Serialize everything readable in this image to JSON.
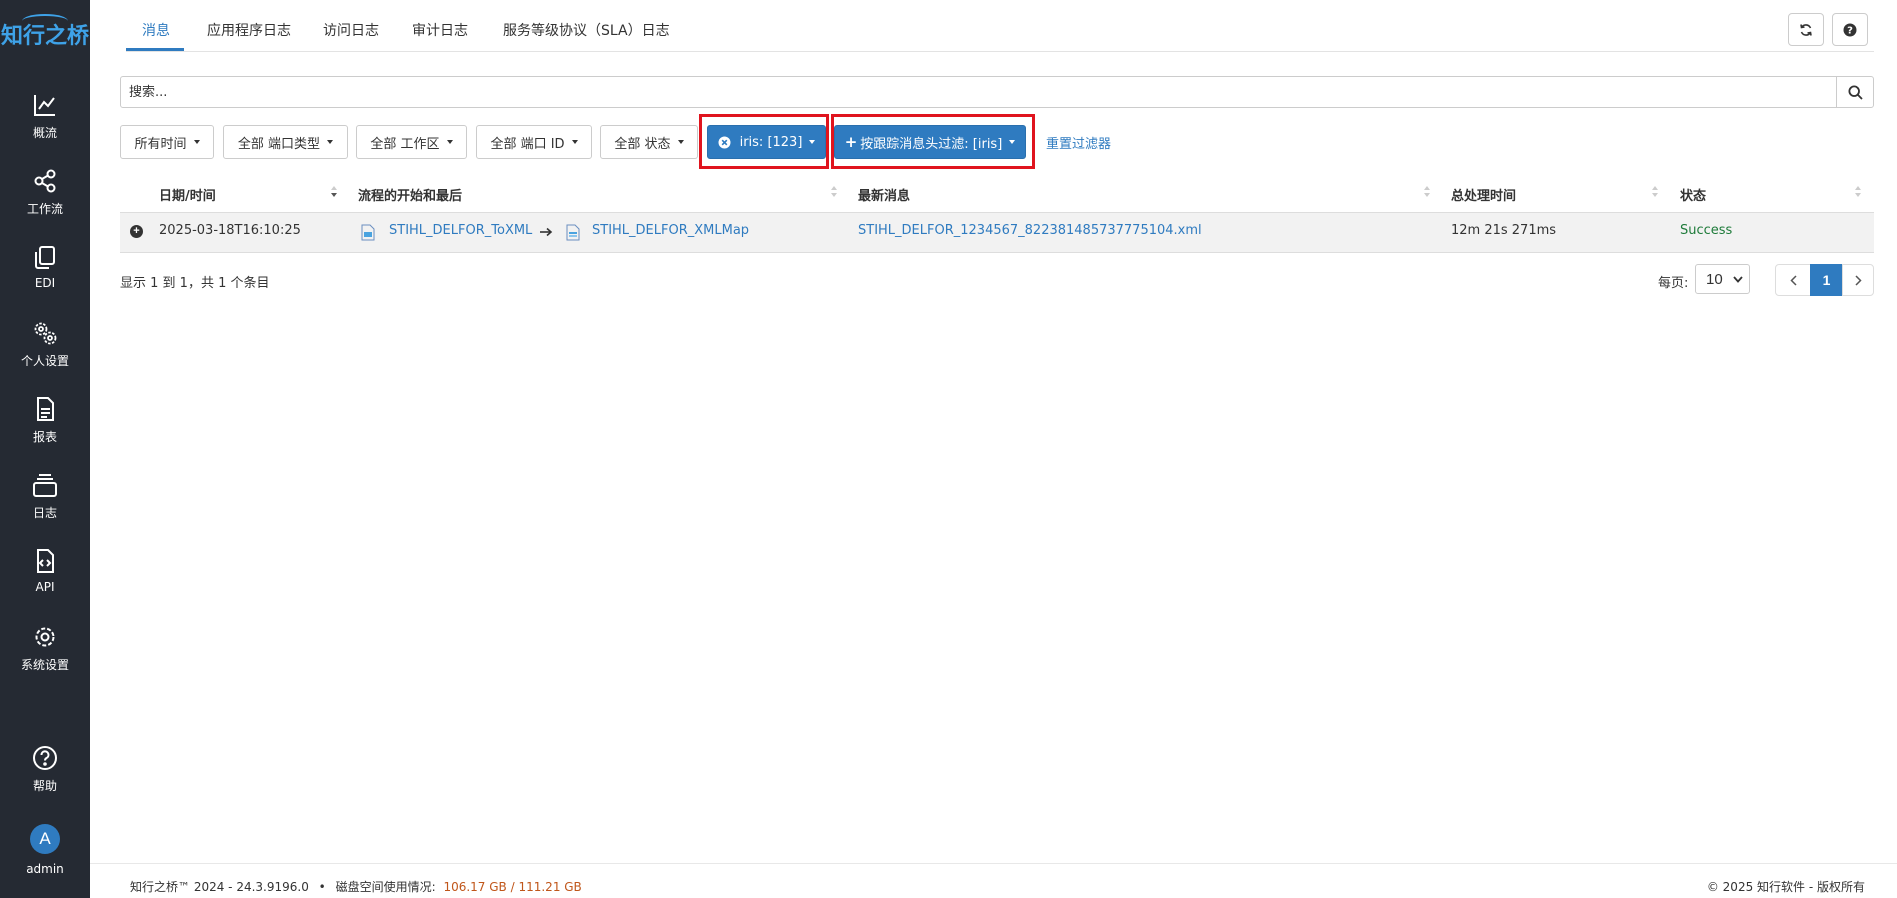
{
  "sidebar": {
    "logo": "知行之桥",
    "items": [
      {
        "label": "概流",
        "icon": "chart-line-icon"
      },
      {
        "label": "工作流",
        "icon": "share-nodes-icon"
      },
      {
        "label": "EDI",
        "icon": "copy-icon"
      },
      {
        "label": "个人设置",
        "icon": "gears-icon"
      },
      {
        "label": "报表",
        "icon": "file-lines-icon"
      },
      {
        "label": "日志",
        "icon": "layers-icon"
      },
      {
        "label": "API",
        "icon": "file-code-icon"
      },
      {
        "label": "系统设置",
        "icon": "gear-icon"
      },
      {
        "label": "帮助",
        "icon": "question-circle-icon"
      }
    ],
    "user": {
      "initial": "A",
      "name": "admin"
    }
  },
  "tabs": [
    {
      "label": "消息",
      "active": true
    },
    {
      "label": "应用程序日志"
    },
    {
      "label": "访问日志"
    },
    {
      "label": "审计日志"
    },
    {
      "label": "服务等级协议（SLA）日志"
    }
  ],
  "search": {
    "placeholder": "搜索..."
  },
  "filters": {
    "time": "所有时间",
    "port_type": "全部 端口类型",
    "workspace": "全部 工作区",
    "port_id": "全部 端口 ID",
    "status": "全部 状态",
    "iris": "iris: [123]",
    "header_filter": "按跟踪消息头过滤: [iris]",
    "reset": "重置过滤器"
  },
  "table": {
    "columns": [
      "日期/时间",
      "流程的开始和最后",
      "最新消息",
      "总处理时间",
      "状态"
    ],
    "rows": [
      {
        "datetime": "2025-03-18T16:10:25",
        "flow_start": "STIHL_DELFOR_ToXML",
        "flow_end": "STIHL_DELFOR_XMLMap",
        "latest_message": "STIHL_DELFOR_1234567_822381485737775104.xml",
        "total_time": "12m 21s 271ms",
        "status": "Success"
      }
    ]
  },
  "pagination": {
    "summary": "显示 1 到 1，共 1 个条目",
    "per_page_label": "每页:",
    "per_page_value": "10",
    "current_page": "1"
  },
  "footer": {
    "version": "知行之桥™ 2024 - 24.3.9196.0",
    "separator": "•",
    "disk_label": "磁盘空间使用情况:",
    "disk_value": "106.17 GB / 111.21 GB",
    "copyright": "© 2025 知行软件 - 版权所有"
  },
  "colors": {
    "sidebar_bg": "#252a33",
    "accent": "#2f7bc0",
    "success": "#1e7b3a",
    "highlight_box": "#e0141e"
  }
}
